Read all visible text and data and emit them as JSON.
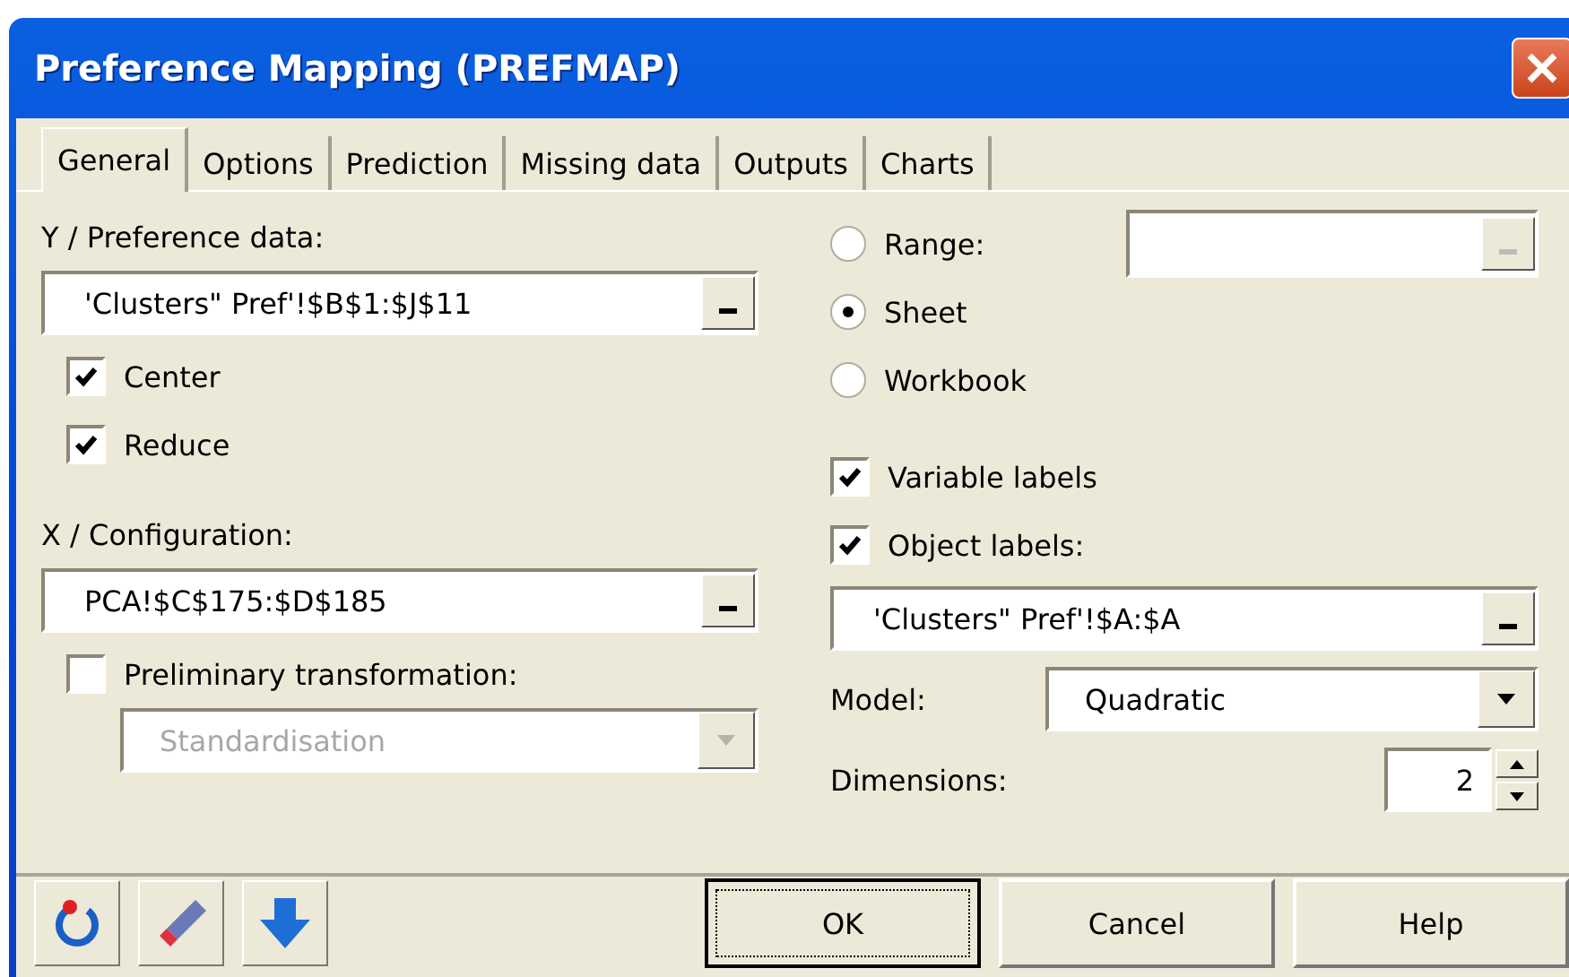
{
  "window": {
    "title": "Preference Mapping (PREFMAP)"
  },
  "tabs": [
    {
      "label": "General",
      "selected": true
    },
    {
      "label": "Options",
      "selected": false
    },
    {
      "label": "Prediction",
      "selected": false
    },
    {
      "label": "Missing data",
      "selected": false
    },
    {
      "label": "Outputs",
      "selected": false
    },
    {
      "label": "Charts",
      "selected": false
    }
  ],
  "y_data": {
    "label": "Y / Preference data:",
    "field": {
      "value": "'Clusters\" Pref'!$B$1:$J$11"
    },
    "options": [
      {
        "label": "Center",
        "checked": true
      },
      {
        "label": "Reduce",
        "checked": true
      }
    ]
  },
  "x_config": {
    "label": "X / Configuration:",
    "field": {
      "value": "PCA!$C$175:$D$185"
    },
    "transform": {
      "label": "Preliminary transformation:",
      "checked": false
    },
    "method": {
      "value": "Standardisation",
      "disabled": true
    }
  },
  "source": {
    "options": [
      {
        "label": "Range:",
        "selected": false
      },
      {
        "label": "Sheet",
        "selected": true
      },
      {
        "label": "Workbook",
        "selected": false
      }
    ],
    "range_field": {
      "disabled": true
    }
  },
  "labels": [
    {
      "label": "Variable labels",
      "checked": true
    },
    {
      "label": "Object labels:",
      "checked": true
    }
  ],
  "object_labels_field": {
    "value": "'Clusters\" Pref'!$A:$A"
  },
  "model": {
    "label": "Model:",
    "value": "Quadratic"
  },
  "dimensions": {
    "label": "Dimensions:",
    "value": "2"
  },
  "buttons": [
    {
      "label": "OK",
      "focused": true
    },
    {
      "label": "Cancel",
      "focused": false
    },
    {
      "label": "Help",
      "focused": false
    }
  ]
}
